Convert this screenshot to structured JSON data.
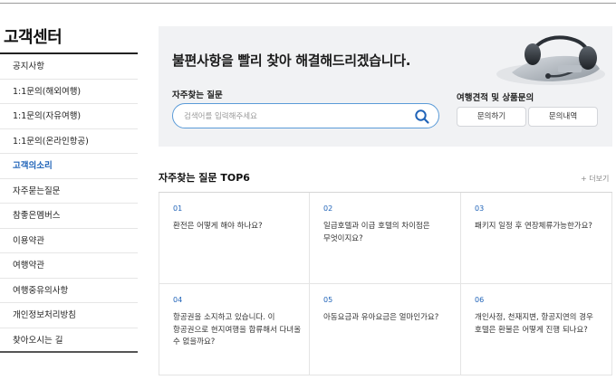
{
  "sidebar": {
    "title": "고객센터",
    "items": [
      {
        "label": "공지사항",
        "active": false
      },
      {
        "label": "1:1문의(해외여행)",
        "active": false
      },
      {
        "label": "1:1문의(자유여행)",
        "active": false
      },
      {
        "label": "1:1문의(온라인항공)",
        "active": false
      },
      {
        "label": "고객의소리",
        "active": true
      },
      {
        "label": "자주묻는질문",
        "active": false
      },
      {
        "label": "참좋은멤버스",
        "active": false
      },
      {
        "label": "이용약관",
        "active": false
      },
      {
        "label": "여행약관",
        "active": false
      },
      {
        "label": "여행중유의사항",
        "active": false
      },
      {
        "label": "개인정보처리방침",
        "active": false
      },
      {
        "label": "찾아오시는 길",
        "active": false
      }
    ]
  },
  "hero": {
    "headline": "불편사항을 빨리 찾아 해결해드리겠습니다.",
    "faq_label": "자주찾는 질문",
    "search_placeholder": "검색어를 입력해주세요",
    "inquiry_label": "여행견적 및 상품문의",
    "ask_button": "문의하기",
    "history_button": "문의내역"
  },
  "faq": {
    "title": "자주찾는 질문 TOP6",
    "more_link": "+ 더보기",
    "items": [
      {
        "num": "01",
        "question": "환전은 어떻게 해야 하나요?"
      },
      {
        "num": "02",
        "question": "일급호텔과 이급 호텔의 차이점은 무엇이지요?"
      },
      {
        "num": "03",
        "question": "패키지 일정 후 연장체류가능한가요?"
      },
      {
        "num": "04",
        "question": "항공권을 소지하고 있습니다. 이 항공권으로 현지여행을 합류해서 다녀올 수 없을까요?"
      },
      {
        "num": "05",
        "question": "아동요금과 유아요금은 얼마인가요?"
      },
      {
        "num": "06",
        "question": "개인사정, 천재지변, 항공지연의 경우 호텔은 환불은 어떻게 진행 되나요?"
      }
    ]
  },
  "colors": {
    "accent": "#1f63b8",
    "search_border": "#5a9bd8",
    "hero_bg": "#f1f2f4"
  }
}
